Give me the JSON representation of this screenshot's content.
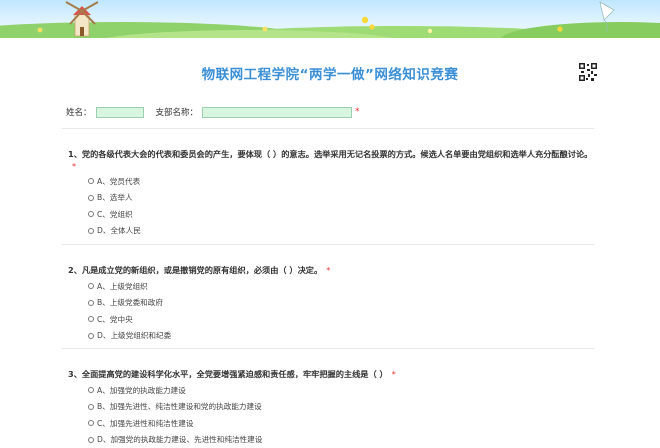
{
  "header": {
    "title": "物联网工程学院“两学一做”网络知识竞赛"
  },
  "form": {
    "name_label": "姓名：",
    "branch_label": "支部名称：",
    "required_mark": "*"
  },
  "questions": [
    {
      "text": "1、党的各级代表大会的代表和委员会的产生，要体现（ ）的意志。选举采用无记名投票的方式。候选人名单要由党组织和选举人充分酝酿讨论。",
      "options": [
        "A、党员代表",
        "B、选举人",
        "C、党组织",
        "D、全体人民"
      ]
    },
    {
      "text": "2、凡是成立党的新组织，或是撤销党的原有组织，必须由（ ）决定。",
      "options": [
        "A、上级党组织",
        "B、上级党委和政府",
        "C、党中央",
        "D、上级党组织和纪委"
      ]
    },
    {
      "text": "3、全面提高党的建设科学化水平，全党要增强紧迫感和责任感，牢牢把握的主线是（ ）",
      "options": [
        "A、加强党的执政能力建设",
        "B、加强先进性、纯洁性建设和党的执政能力建设",
        "C、加强先进性和纯洁性建设",
        "D、加强党的执政能力建设、先进性和纯洁性建设"
      ]
    }
  ],
  "colors": {
    "title": "#3b8fd6",
    "required": "#e33333",
    "field_bg": "#d8f5e0"
  }
}
